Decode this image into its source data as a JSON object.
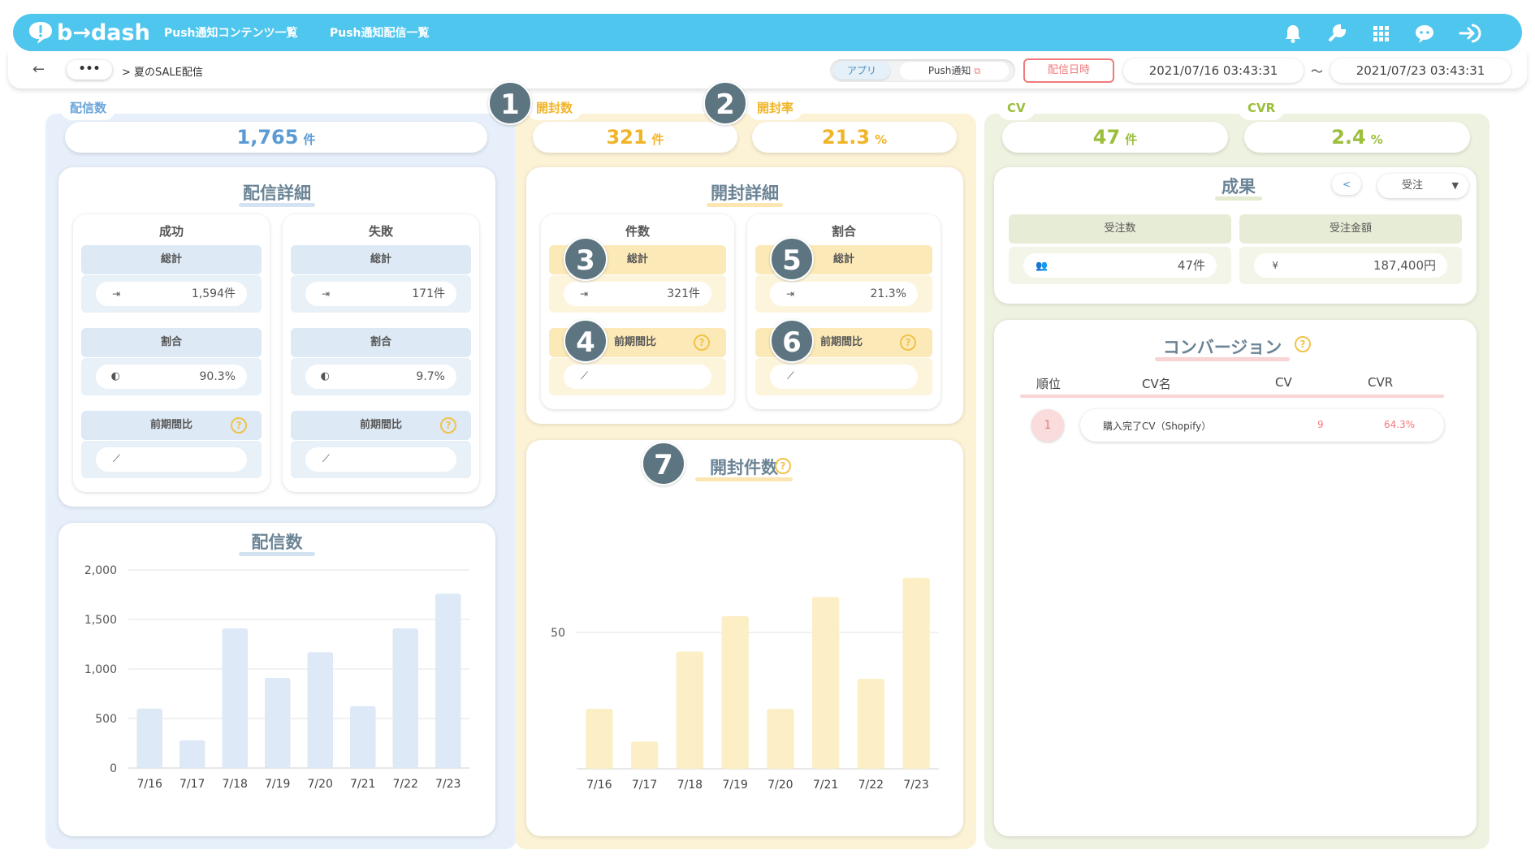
{
  "header": {
    "logo": "b→dash",
    "nav": [
      "Push通知コンテンツ一覧",
      "Push通知配信一覧"
    ],
    "icons": [
      "bell-icon",
      "wrench-icon",
      "grid-icon",
      "chat-icon",
      "logout-icon"
    ]
  },
  "subbar": {
    "back": "←",
    "more": "•••",
    "breadcrumb": "> 夏のSALE配信",
    "toggle_app": "アプリ",
    "toggle_push": "Push通知",
    "date_button": "配信日時",
    "date_from": "2021/07/16 03:43:31",
    "tilde": "〜",
    "date_to": "2021/07/23 03:43:31"
  },
  "kpis": {
    "delivery": {
      "label": "配信数",
      "value": "1,765",
      "unit": "件"
    },
    "opens": {
      "label": "開封数",
      "value": "321",
      "unit": "件"
    },
    "open_rate": {
      "label": "開封率",
      "value": "21.3",
      "unit": "%"
    },
    "cv": {
      "label": "CV",
      "value": "47",
      "unit": "件"
    },
    "cvr": {
      "label": "CVR",
      "value": "2.4",
      "unit": "%"
    }
  },
  "badges": [
    "1",
    "2",
    "3",
    "4",
    "5",
    "6",
    "7"
  ],
  "delivery_detail": {
    "title": "配信詳細",
    "success": {
      "title": "成功",
      "total_label": "総計",
      "total": "1,594件",
      "ratio_label": "割合",
      "ratio": "90.3%",
      "prev_label": "前期間比",
      "prev": ""
    },
    "failure": {
      "title": "失敗",
      "total_label": "総計",
      "total": "171件",
      "ratio_label": "割合",
      "ratio": "9.7%",
      "prev_label": "前期間比",
      "prev": ""
    }
  },
  "open_detail": {
    "title": "開封詳細",
    "count": {
      "title": "件数",
      "total_label": "総計",
      "total": "321件",
      "prev_label": "前期間比",
      "prev": ""
    },
    "ratio": {
      "title": "割合",
      "total_label": "総計",
      "total": "21.3%",
      "prev_label": "前期間比",
      "prev": ""
    }
  },
  "results": {
    "title": "成果",
    "select": "受注",
    "orders_label": "受注数",
    "orders": "47件",
    "amount_label": "受注金額",
    "amount": "187,400円"
  },
  "conversion": {
    "title": "コンバージョン",
    "headers": [
      "順位",
      "CV名",
      "CV",
      "CVR"
    ],
    "rows": [
      {
        "rank": "1",
        "name": "購入完了CV（Shopify）",
        "cv": "9",
        "cvr": "64.3%"
      }
    ]
  },
  "help_mark": "?",
  "chart_titles": {
    "delivery": "配信数",
    "opens": "開封件数"
  },
  "chart_data": [
    {
      "type": "bar",
      "title": "配信数",
      "categories": [
        "7/16",
        "7/17",
        "7/18",
        "7/19",
        "7/20",
        "7/21",
        "7/22",
        "7/23"
      ],
      "values": [
        600,
        280,
        1410,
        910,
        1170,
        625,
        1410,
        1760
      ],
      "ylim": [
        0,
        2000
      ],
      "yticks": [
        "0",
        "500",
        "1,000",
        "1,500",
        "2,000"
      ],
      "grid": true,
      "color": "#dde9f6"
    },
    {
      "type": "bar",
      "title": "開封件数",
      "categories": [
        "7/16",
        "7/17",
        "7/18",
        "7/19",
        "7/20",
        "7/21",
        "7/22",
        "7/23"
      ],
      "values": [
        22,
        10,
        43,
        56,
        22,
        63,
        33,
        70
      ],
      "ylim": [
        0,
        100
      ],
      "yticks": [
        "50"
      ],
      "grid": true,
      "color": "#fcefc6"
    }
  ]
}
